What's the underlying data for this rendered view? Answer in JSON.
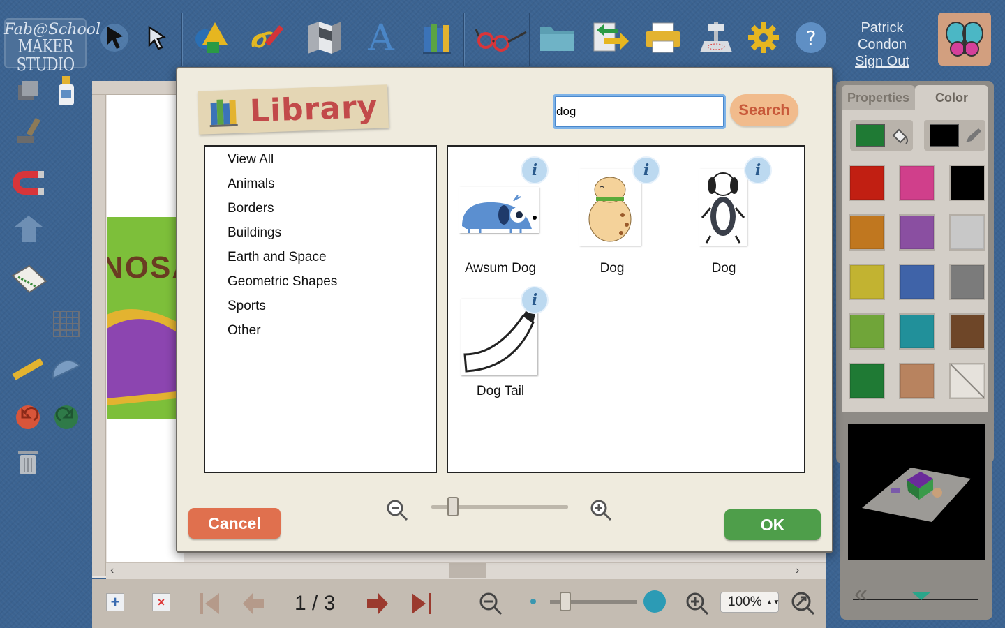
{
  "app": {
    "logo_line1": "Fab@School",
    "logo_line2": "MAKER STUDIO"
  },
  "user": {
    "first": "Patrick",
    "last": "Condon",
    "sign_out": "Sign Out"
  },
  "toolbar": {
    "icons": [
      "select-arrow-icon",
      "direct-select-icon",
      "shapes-icon",
      "draw-icon",
      "3d-fold-icon",
      "text-icon",
      "library-icon",
      "glasses-view-icon",
      "folder-icon",
      "import-export-icon",
      "print-icon",
      "cutter-icon",
      "settings-gear-icon",
      "help-icon"
    ]
  },
  "library": {
    "title": "Library",
    "search_value": "dog",
    "search_button": "Search",
    "categories": [
      "View All",
      "Animals",
      "Borders",
      "Buildings",
      "Earth and Space",
      "Geometric Shapes",
      "Sports",
      "Other"
    ],
    "results": [
      {
        "label": "Awsum Dog",
        "icon": "awsum-dog-thumbnail"
      },
      {
        "label": "Dog",
        "icon": "dog-thumbnail"
      },
      {
        "label": "Dog",
        "icon": "spotted-dog-thumbnail"
      },
      {
        "label": "Dog Tail",
        "icon": "dog-tail-thumbnail"
      }
    ],
    "cancel": "Cancel",
    "ok": "OK",
    "zoom_level": 0.15
  },
  "right_panel": {
    "tabs": [
      "Properties",
      "Color"
    ],
    "fill_color": "#1f7a34",
    "stroke_color": "#000000",
    "swatches": [
      "#c11f12",
      "#d03f8b",
      "#000000",
      "#c0771f",
      "#8a4fa1",
      "#c8c8c8",
      "#c2b331",
      "#3f63a8",
      "#7b7b7b",
      "#70a539",
      "#21909a",
      "#6e4628",
      "#1f7a34",
      "#b8835f",
      "none"
    ]
  },
  "page_nav": {
    "page": "1 / 3",
    "zoom": "100%"
  },
  "canvas": {
    "partial_text": "NOSA"
  }
}
